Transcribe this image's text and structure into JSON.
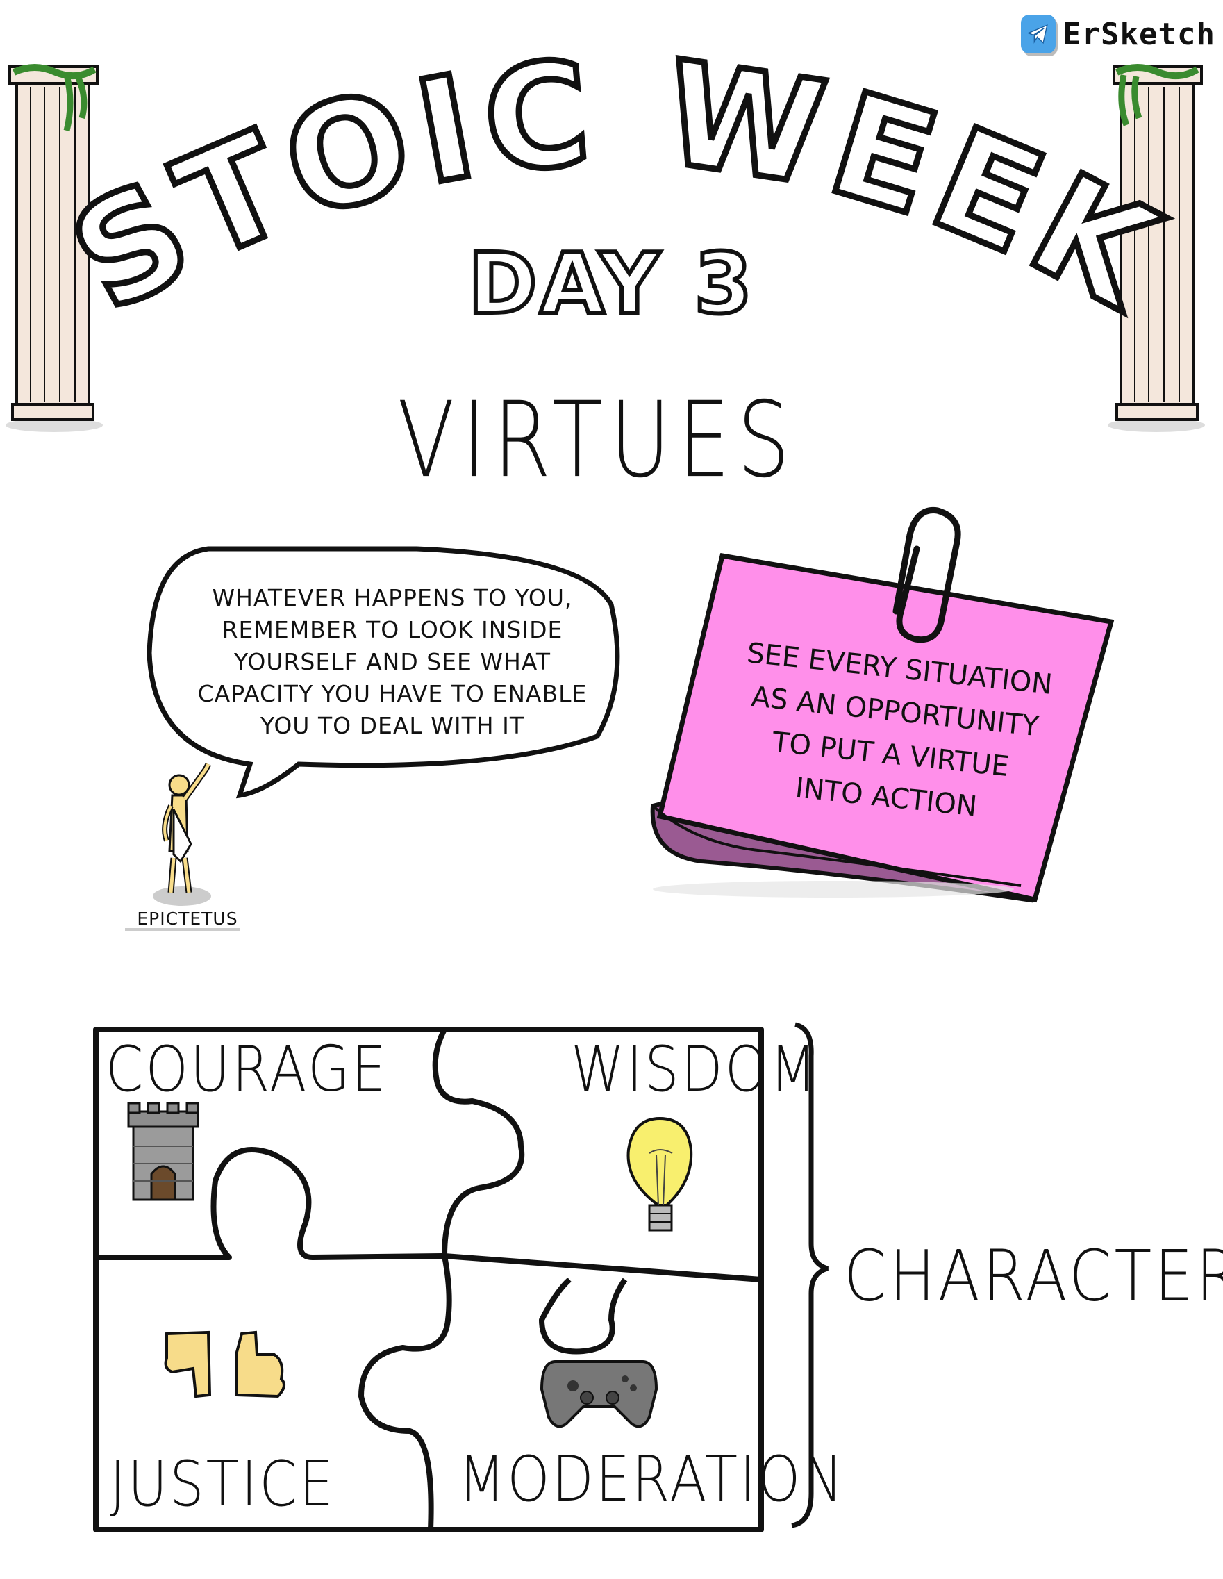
{
  "brand": {
    "name": "ErSketch",
    "icon": "telegram-icon",
    "icon_color": "#4aa3e8"
  },
  "header": {
    "title": "STOIC WEEK",
    "day": "DAY 3",
    "subtitle": "VIRTUES"
  },
  "quote": {
    "lines": [
      "WHATEVER HAPPENS TO YOU,",
      "REMEMBER TO LOOK INSIDE",
      "YOURSELF AND SEE WHAT",
      "CAPACITY YOU HAVE TO ENABLE",
      "YOU TO DEAL WITH IT"
    ],
    "author": "EPICTETUS"
  },
  "note": {
    "lines": [
      "SEE EVERY SITUATION",
      "AS AN OPPORTUNITY",
      "TO PUT A VIRTUE",
      "INTO ACTION"
    ],
    "color": "#ff8fea",
    "icon": "paperclip-icon"
  },
  "virtues": {
    "courage": {
      "label": "COURAGE",
      "icon": "tower-icon"
    },
    "wisdom": {
      "label": "WISDOM",
      "icon": "lightbulb-icon"
    },
    "justice": {
      "label": "JUSTICE",
      "icon": "thumbs-icon"
    },
    "moderation": {
      "label": "MODERATION",
      "icon": "gamepad-icon"
    }
  },
  "summary": {
    "label": "CHARACTER"
  }
}
